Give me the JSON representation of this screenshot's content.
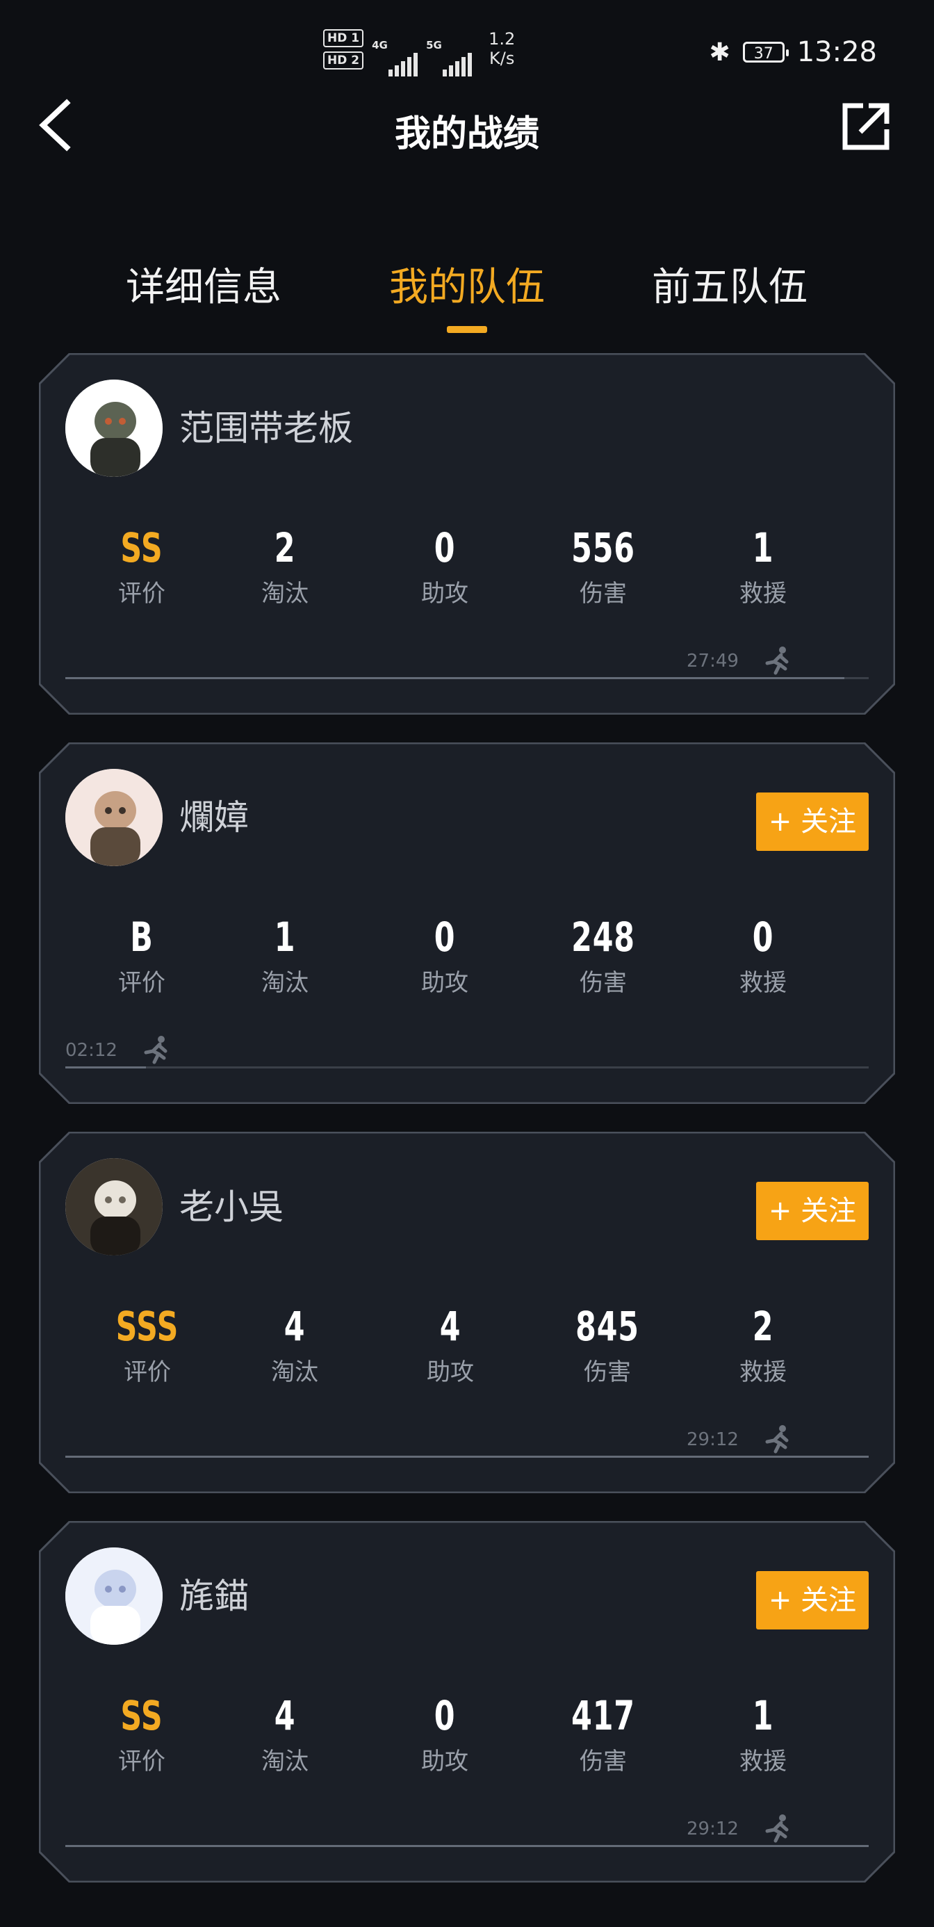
{
  "status_bar": {
    "hd1": "HD 1",
    "hd2": "HD 2",
    "sig1_tag": "4G",
    "sig2_tag": "5G",
    "net_speed_value": "1.2",
    "net_speed_unit": "K/s",
    "battery": "37",
    "time": "13:28"
  },
  "header": {
    "title": "我的战绩"
  },
  "tabs": [
    {
      "label": "详细信息",
      "active": false
    },
    {
      "label": "我的队伍",
      "active": true
    },
    {
      "label": "前五队伍",
      "active": false
    }
  ],
  "labels": {
    "rating": "评价",
    "kills": "淘汰",
    "assists": "助攻",
    "damage": "伤害",
    "rescues": "救援",
    "follow": "+ 关注"
  },
  "players": [
    {
      "name": "范围带老板",
      "rating": "SS",
      "rating_gold": true,
      "kills": "2",
      "assists": "0",
      "damage": "556",
      "rescues": "1",
      "time": "27:49",
      "survival_fraction": 0.97,
      "follow": false
    },
    {
      "name": "爛嫜",
      "rating": "B",
      "rating_gold": false,
      "kills": "1",
      "assists": "0",
      "damage": "248",
      "rescues": "0",
      "time": "02:12",
      "survival_fraction": 0.1,
      "follow": true
    },
    {
      "name": "老小吳",
      "rating": "SSS",
      "rating_gold": true,
      "kills": "4",
      "assists": "4",
      "damage": "845",
      "rescues": "2",
      "time": "29:12",
      "survival_fraction": 1.0,
      "follow": true
    },
    {
      "name": "旄錨",
      "rating": "SS",
      "rating_gold": true,
      "kills": "4",
      "assists": "0",
      "damage": "417",
      "rescues": "1",
      "time": "29:12",
      "survival_fraction": 1.0,
      "follow": true
    }
  ]
}
